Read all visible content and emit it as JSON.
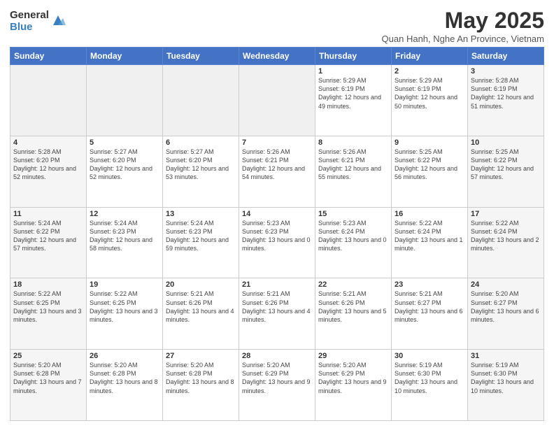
{
  "logo": {
    "general": "General",
    "blue": "Blue"
  },
  "header": {
    "title": "May 2025",
    "subtitle": "Quan Hanh, Nghe An Province, Vietnam"
  },
  "weekdays": [
    "Sunday",
    "Monday",
    "Tuesday",
    "Wednesday",
    "Thursday",
    "Friday",
    "Saturday"
  ],
  "weeks": [
    [
      {
        "day": "",
        "empty": true
      },
      {
        "day": "",
        "empty": true
      },
      {
        "day": "",
        "empty": true
      },
      {
        "day": "",
        "empty": true
      },
      {
        "day": "1",
        "sunrise": "5:29 AM",
        "sunset": "6:19 PM",
        "daylight": "12 hours and 49 minutes."
      },
      {
        "day": "2",
        "sunrise": "5:29 AM",
        "sunset": "6:19 PM",
        "daylight": "12 hours and 50 minutes."
      },
      {
        "day": "3",
        "sunrise": "5:28 AM",
        "sunset": "6:19 PM",
        "daylight": "12 hours and 51 minutes."
      }
    ],
    [
      {
        "day": "4",
        "sunrise": "5:28 AM",
        "sunset": "6:20 PM",
        "daylight": "12 hours and 52 minutes."
      },
      {
        "day": "5",
        "sunrise": "5:27 AM",
        "sunset": "6:20 PM",
        "daylight": "12 hours and 52 minutes."
      },
      {
        "day": "6",
        "sunrise": "5:27 AM",
        "sunset": "6:20 PM",
        "daylight": "12 hours and 53 minutes."
      },
      {
        "day": "7",
        "sunrise": "5:26 AM",
        "sunset": "6:21 PM",
        "daylight": "12 hours and 54 minutes."
      },
      {
        "day": "8",
        "sunrise": "5:26 AM",
        "sunset": "6:21 PM",
        "daylight": "12 hours and 55 minutes."
      },
      {
        "day": "9",
        "sunrise": "5:25 AM",
        "sunset": "6:22 PM",
        "daylight": "12 hours and 56 minutes."
      },
      {
        "day": "10",
        "sunrise": "5:25 AM",
        "sunset": "6:22 PM",
        "daylight": "12 hours and 57 minutes."
      }
    ],
    [
      {
        "day": "11",
        "sunrise": "5:24 AM",
        "sunset": "6:22 PM",
        "daylight": "12 hours and 57 minutes."
      },
      {
        "day": "12",
        "sunrise": "5:24 AM",
        "sunset": "6:23 PM",
        "daylight": "12 hours and 58 minutes."
      },
      {
        "day": "13",
        "sunrise": "5:24 AM",
        "sunset": "6:23 PM",
        "daylight": "12 hours and 59 minutes."
      },
      {
        "day": "14",
        "sunrise": "5:23 AM",
        "sunset": "6:23 PM",
        "daylight": "13 hours and 0 minutes."
      },
      {
        "day": "15",
        "sunrise": "5:23 AM",
        "sunset": "6:24 PM",
        "daylight": "13 hours and 0 minutes."
      },
      {
        "day": "16",
        "sunrise": "5:22 AM",
        "sunset": "6:24 PM",
        "daylight": "13 hours and 1 minute."
      },
      {
        "day": "17",
        "sunrise": "5:22 AM",
        "sunset": "6:24 PM",
        "daylight": "13 hours and 2 minutes."
      }
    ],
    [
      {
        "day": "18",
        "sunrise": "5:22 AM",
        "sunset": "6:25 PM",
        "daylight": "13 hours and 3 minutes."
      },
      {
        "day": "19",
        "sunrise": "5:22 AM",
        "sunset": "6:25 PM",
        "daylight": "13 hours and 3 minutes."
      },
      {
        "day": "20",
        "sunrise": "5:21 AM",
        "sunset": "6:26 PM",
        "daylight": "13 hours and 4 minutes."
      },
      {
        "day": "21",
        "sunrise": "5:21 AM",
        "sunset": "6:26 PM",
        "daylight": "13 hours and 4 minutes."
      },
      {
        "day": "22",
        "sunrise": "5:21 AM",
        "sunset": "6:26 PM",
        "daylight": "13 hours and 5 minutes."
      },
      {
        "day": "23",
        "sunrise": "5:21 AM",
        "sunset": "6:27 PM",
        "daylight": "13 hours and 6 minutes."
      },
      {
        "day": "24",
        "sunrise": "5:20 AM",
        "sunset": "6:27 PM",
        "daylight": "13 hours and 6 minutes."
      }
    ],
    [
      {
        "day": "25",
        "sunrise": "5:20 AM",
        "sunset": "6:28 PM",
        "daylight": "13 hours and 7 minutes."
      },
      {
        "day": "26",
        "sunrise": "5:20 AM",
        "sunset": "6:28 PM",
        "daylight": "13 hours and 8 minutes."
      },
      {
        "day": "27",
        "sunrise": "5:20 AM",
        "sunset": "6:28 PM",
        "daylight": "13 hours and 8 minutes."
      },
      {
        "day": "28",
        "sunrise": "5:20 AM",
        "sunset": "6:29 PM",
        "daylight": "13 hours and 9 minutes."
      },
      {
        "day": "29",
        "sunrise": "5:20 AM",
        "sunset": "6:29 PM",
        "daylight": "13 hours and 9 minutes."
      },
      {
        "day": "30",
        "sunrise": "5:19 AM",
        "sunset": "6:30 PM",
        "daylight": "13 hours and 10 minutes."
      },
      {
        "day": "31",
        "sunrise": "5:19 AM",
        "sunset": "6:30 PM",
        "daylight": "13 hours and 10 minutes."
      }
    ]
  ]
}
